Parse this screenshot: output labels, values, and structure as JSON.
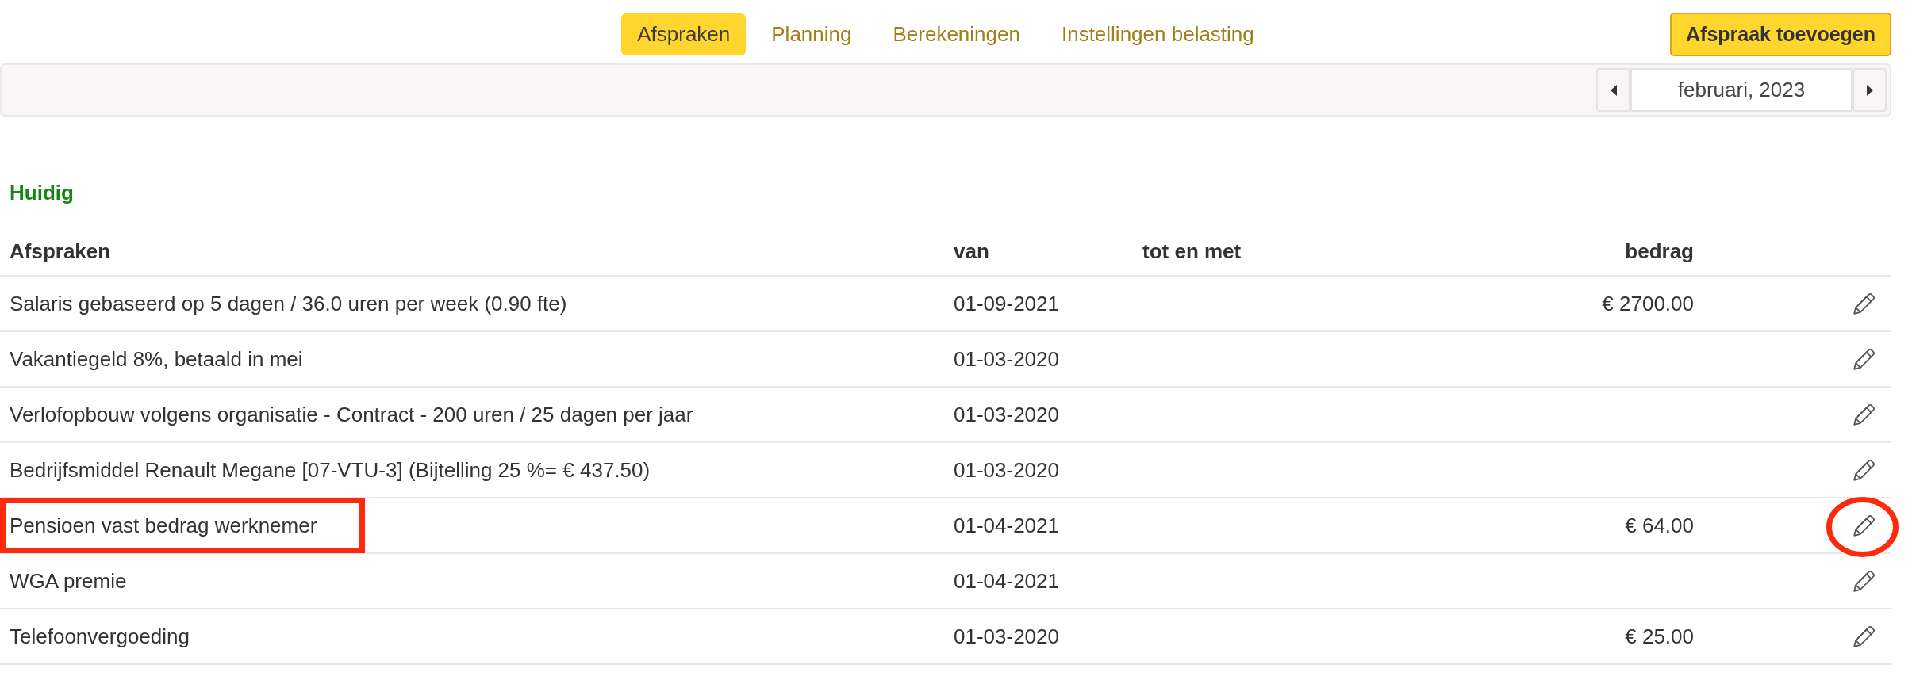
{
  "tabs": [
    {
      "label": "Afspraken",
      "selected": true
    },
    {
      "label": "Planning",
      "selected": false
    },
    {
      "label": "Berekeningen",
      "selected": false
    },
    {
      "label": "Instellingen belasting",
      "selected": false
    }
  ],
  "add_button": "Afspraak toevoegen",
  "toolbar": {
    "period": "februari, 2023"
  },
  "section": {
    "title": "Huidig",
    "columns": [
      {
        "label": "Afspraken",
        "kind": "text"
      },
      {
        "label": "van",
        "kind": "date"
      },
      {
        "label": "tot en met",
        "kind": "date"
      },
      {
        "label": "bedrag",
        "kind": "amount"
      }
    ],
    "rows": [
      {
        "name": "Salaris gebaseerd op 5 dagen / 36.0 uren per week (0.90 fte)",
        "from": "01-09-2021",
        "amount": "€ 2700.00",
        "name_highlighted": false,
        "edit_highlighted": false
      },
      {
        "name": "Vakantiegeld 8%, betaald in mei",
        "from": "01-03-2020",
        "name_highlighted": false,
        "edit_highlighted": false
      },
      {
        "name": "Verlofopbouw volgens organisatie - Contract - 200 uren / 25 dagen per jaar",
        "from": "01-03-2020",
        "name_highlighted": false,
        "edit_highlighted": false
      },
      {
        "name": "Bedrijfsmiddel Renault Megane [07-VTU-3] (Bijtelling 25 %= € 437.50)",
        "from": "01-03-2020",
        "name_highlighted": false,
        "edit_highlighted": false
      },
      {
        "name": "Pensioen vast bedrag werknemer",
        "from": "01-04-2021",
        "amount": "€ 64.00",
        "name_highlighted": true,
        "edit_highlighted": true
      },
      {
        "name": "WGA premie",
        "from": "01-04-2021",
        "name_highlighted": false,
        "edit_highlighted": false
      },
      {
        "name": "Telefoonvergoeding",
        "from": "01-03-2020",
        "amount": "€ 25.00",
        "name_highlighted": false,
        "edit_highlighted": false
      }
    ]
  }
}
